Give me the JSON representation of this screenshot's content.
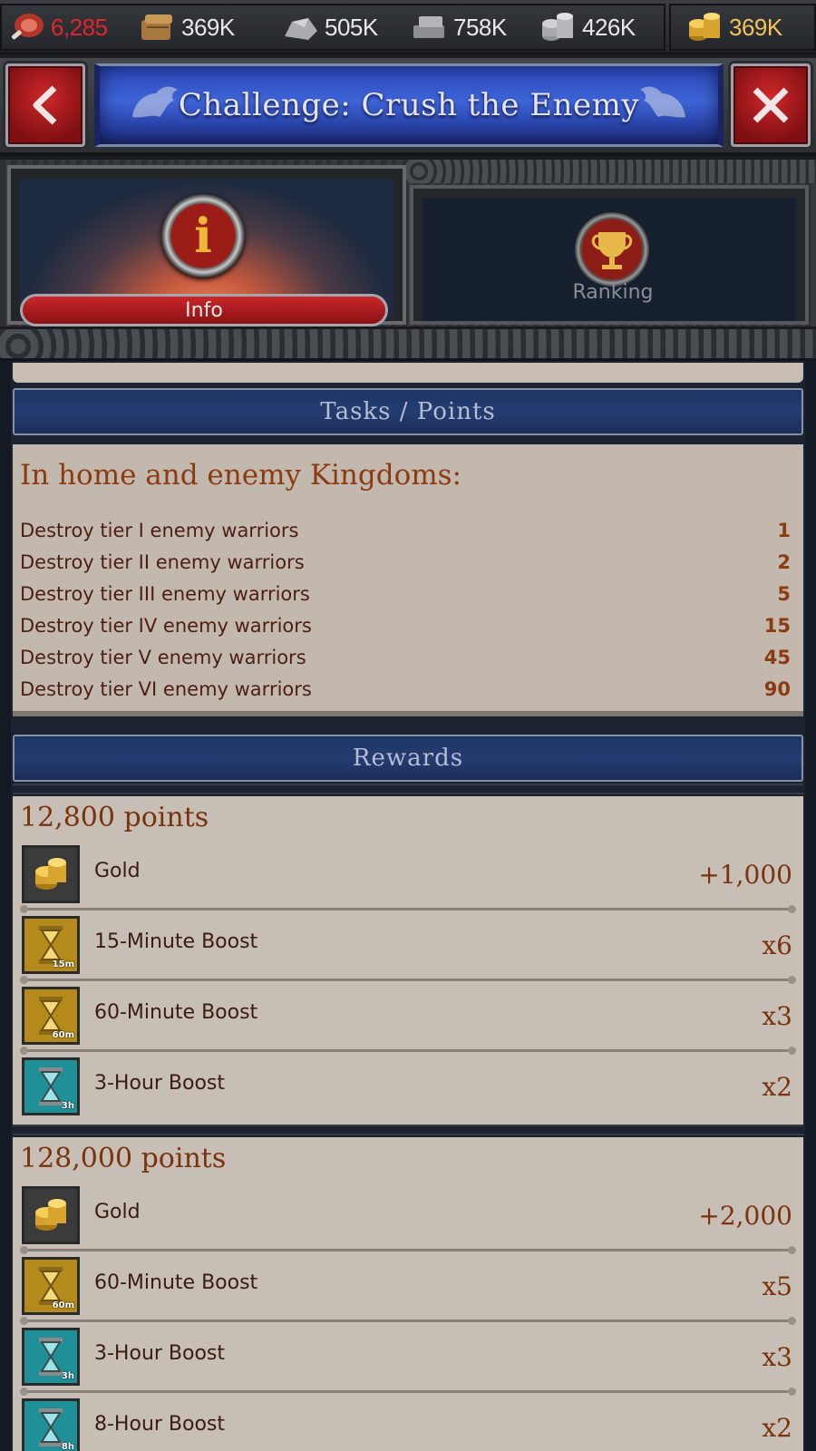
{
  "resources": {
    "food": "6,285",
    "wood": "369K",
    "stone": "505K",
    "iron": "758K",
    "silver": "426K",
    "gold": "369K",
    "food_color": "#e0262a",
    "gold_color": "#f3c35a",
    "icons": [
      "meat-icon",
      "wood-icon",
      "stone-icon",
      "iron-icon",
      "silver-icon",
      "gold-coins-icon"
    ]
  },
  "header": {
    "title": "Challenge: Crush the Enemy",
    "accent": "#3d63d6"
  },
  "tabs": [
    {
      "label": "Info",
      "active": true
    },
    {
      "label": "Ranking",
      "active": false
    }
  ],
  "tasks": {
    "section_title": "Tasks / Points",
    "heading": "In home and enemy Kingdoms:",
    "rows": [
      {
        "label": "Destroy tier I enemy warriors",
        "points": "1"
      },
      {
        "label": "Destroy tier II enemy warriors",
        "points": "2"
      },
      {
        "label": "Destroy tier III enemy warriors",
        "points": "5"
      },
      {
        "label": "Destroy tier IV enemy warriors",
        "points": "15"
      },
      {
        "label": "Destroy tier V enemy warriors",
        "points": "45"
      },
      {
        "label": "Destroy tier VI enemy warriors",
        "points": "90"
      }
    ]
  },
  "rewards": {
    "section_title": "Rewards",
    "tiers": [
      {
        "points": "12,800 points",
        "items": [
          {
            "name": "Gold",
            "amount": "+1,000",
            "icon": "gold-coins-icon",
            "badge": ""
          },
          {
            "name": "15-Minute Boost",
            "amount": "x6",
            "icon": "hourglass-gold-icon",
            "badge": "15m"
          },
          {
            "name": "60-Minute Boost",
            "amount": "x3",
            "icon": "hourglass-gold-icon",
            "badge": "60m"
          },
          {
            "name": "3-Hour Boost",
            "amount": "x2",
            "icon": "hourglass-teal-icon",
            "badge": "3h"
          }
        ]
      },
      {
        "points": "128,000 points",
        "items": [
          {
            "name": "Gold",
            "amount": "+2,000",
            "icon": "gold-coins-icon",
            "badge": ""
          },
          {
            "name": "60-Minute Boost",
            "amount": "x5",
            "icon": "hourglass-gold-icon",
            "badge": "60m"
          },
          {
            "name": "3-Hour Boost",
            "amount": "x3",
            "icon": "hourglass-teal-icon",
            "badge": "3h"
          },
          {
            "name": "8-Hour Boost",
            "amount": "x2",
            "icon": "hourglass-teal-icon",
            "badge": "8h"
          }
        ]
      }
    ]
  }
}
